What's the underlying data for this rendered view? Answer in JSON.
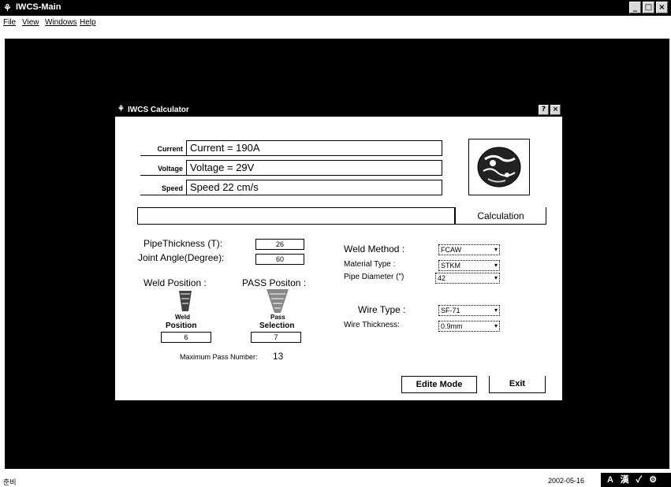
{
  "window": {
    "title": "IWCS-Main",
    "app_icon": "app-icon",
    "controls": [
      "minimize-icon",
      "maximize-icon",
      "close-icon"
    ]
  },
  "menubar": {
    "items": [
      "File",
      "View",
      "Windows",
      "Help"
    ]
  },
  "dialog": {
    "title": "IWCS Calculator",
    "labels": {
      "current": "Current",
      "voltage": "Voltage",
      "speed": "Speed"
    },
    "values": {
      "current": "Current = 190A",
      "voltage": "Voltage = 29V",
      "speed": "Speed   22 cm/s",
      "result": ""
    },
    "calculation_button": "Calculation",
    "pipe_thickness_label": "PipeThickness (T):",
    "pipe_thickness_value": "26",
    "joint_angle_label": "Joint Angle(Degree):",
    "joint_angle_value": "60",
    "weld_position_label": "Weld Position :",
    "pass_position_label": "PASS Positon :",
    "weld_image_caption": "Weld",
    "weld_image_caption2": "Position",
    "weld_position_value": "6",
    "pass_image_caption": "Pass",
    "pass_image_caption2": "Selection",
    "pass_selection_value": "7",
    "max_pass_label": "Maximum Pass Number:",
    "max_pass_value": "13",
    "weld_method_label": "Weld Method :",
    "weld_method_value": "FCAW",
    "material_type_label": "Material Type :",
    "material_type_value": "STKM",
    "pipe_diameter_label": "Pipe Diameter (\")",
    "pipe_diameter_value": "42",
    "wire_type_label": "Wire Type :",
    "wire_type_value": "SF-71",
    "wire_thickness_label": "Wire Thickness:",
    "wire_thickness_value": "0.9mm",
    "edit_mode_button": "Edite Mode",
    "exit_button": "Exit"
  },
  "statusbar": {
    "left": "준비",
    "date": "2002-05-16",
    "tray": "A 漢 ✓ ⚙"
  }
}
